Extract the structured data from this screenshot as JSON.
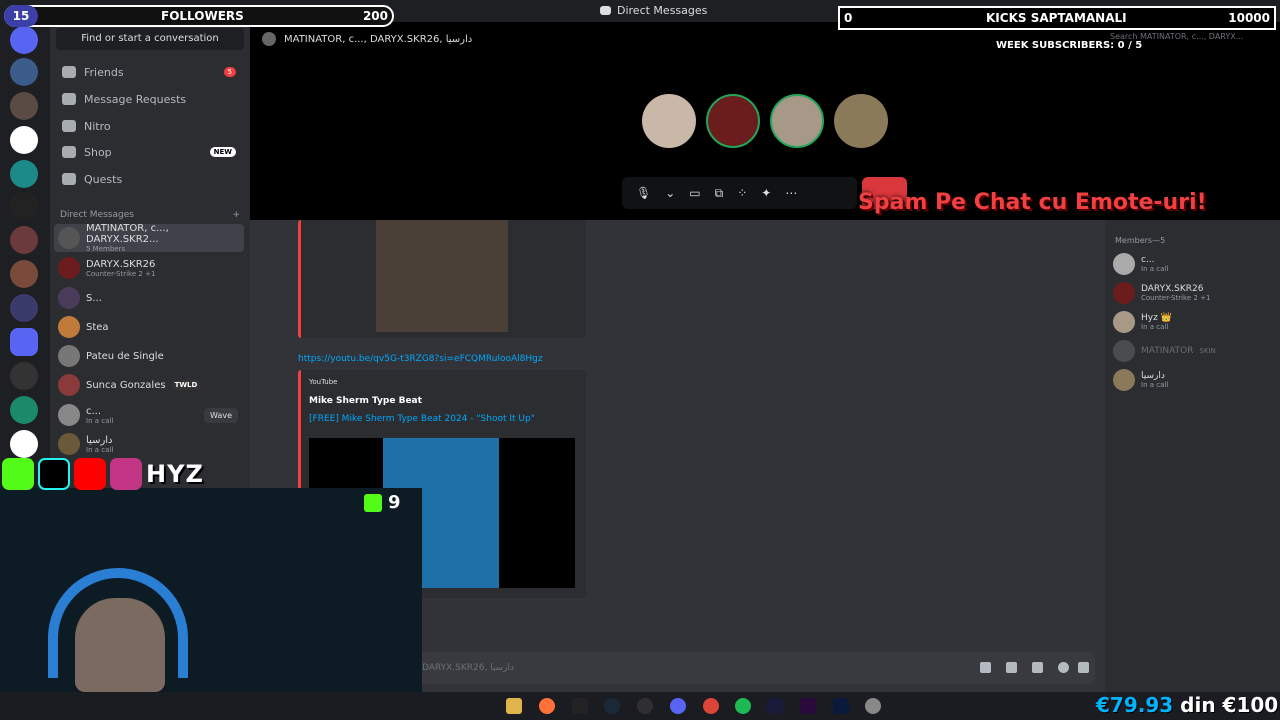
{
  "window": {
    "title": "Direct Messages"
  },
  "overlays": {
    "followers": {
      "level": "15",
      "label": "FOLLOWERS",
      "count": "200"
    },
    "kicks": {
      "current": "0",
      "label": "KICKS SAPTAMANALI",
      "goal": "10000"
    },
    "week_subs": "WEEK SUBSCRIBERS: 0 / 5",
    "spam_text": "Spam Pe Chat cu Emote-uri!",
    "socials_name": "HYZ",
    "kick_count": "9",
    "money": {
      "amount": "€79.93",
      "din": "din",
      "goal": "€100"
    }
  },
  "sidebar": {
    "search": "Find or start a conversation",
    "nav": [
      {
        "label": "Friends",
        "badge": "5"
      },
      {
        "label": "Message Requests"
      },
      {
        "label": "Nitro"
      },
      {
        "label": "Shop",
        "tag": "NEW"
      },
      {
        "label": "Quests"
      }
    ],
    "dm_header": "Direct Messages",
    "dm_add": "+",
    "dms": [
      {
        "name": "MATINATOR, c..., DARYX.SKR2...",
        "sub": "5 Members"
      },
      {
        "name": "DARYX.SKR26",
        "sub": "Counter-Strike 2 +1"
      },
      {
        "name": "S..."
      },
      {
        "name": "Stea"
      },
      {
        "name": "Pateu de Single"
      },
      {
        "name": "Sunca Gonzales",
        "tag": "TWLD"
      },
      {
        "name": "c...",
        "sub": "In a call",
        "action": "Wave"
      },
      {
        "name": "دارسيا",
        "sub": "In a call"
      }
    ]
  },
  "call": {
    "title": "MATINATOR, c..., DARYX.SKR26, دارسيا"
  },
  "search_top": "Search MATINATOR, c..., DARYX...",
  "chat": {
    "link": "https://youtu.be/qv5G-t3RZG8?si=eFCQMRulooAl8Hgz",
    "embed_provider": "YouTube",
    "embed_author": "Mike Sherm Type Beat",
    "embed_title": "[FREE] Mike Sherm Type Beat 2024 - \"Shoot It Up\"",
    "composer_placeholder": "DARYX.SKR26, دارسيا"
  },
  "members": {
    "header": "Members—5",
    "list": [
      {
        "name": "c...",
        "sub": "In a call"
      },
      {
        "name": "DARYX.SKR26",
        "sub": "Counter-Strike 2 +1"
      },
      {
        "name": "Hyz 👑",
        "sub": "In a call"
      },
      {
        "name": "MATINATOR",
        "tag": "SKIN"
      },
      {
        "name": "دارسيا",
        "sub": "In a call"
      }
    ]
  },
  "colors": {
    "accent": "#5865f2",
    "danger": "#f23f42",
    "link": "#00a8fc"
  }
}
